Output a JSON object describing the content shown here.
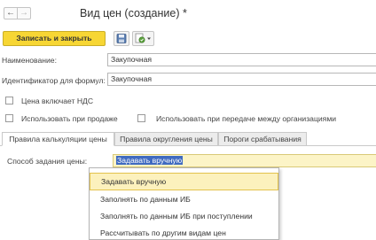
{
  "nav": {
    "back_icon": "arrow-left-icon",
    "forward_icon": "arrow-right-icon"
  },
  "title": "Вид цен (создание) *",
  "toolbar": {
    "save_close_label": "Записать и закрыть",
    "save_icon": "floppy-disk-icon",
    "generate_icon": "generate-dropdown-icon"
  },
  "form": {
    "name_label": "Наименование:",
    "name_value": "Закупочная",
    "formula_id_label": "Идентификатор для формул:",
    "formula_id_value": "Закупочная",
    "vat_checkbox_label": "Цена включает НДС",
    "vat_checked": false,
    "use_sale_label": "Использовать при продаже",
    "use_sale_checked": false,
    "use_transfer_label": "Использовать при передаче между организациями",
    "use_transfer_checked": false
  },
  "tabs": [
    {
      "label": "Правила калькуляции цены",
      "active": true
    },
    {
      "label": "Правила округления цены",
      "active": false
    },
    {
      "label": "Пороги срабатывания",
      "active": false
    }
  ],
  "pricing": {
    "method_label": "Способ задания цены:",
    "method_value": "Задавать вручную",
    "options": [
      "Задавать вручную",
      "Заполнять по данным ИБ",
      "Заполнять по данным ИБ при поступлении",
      "Рассчитывать по другим видам цен"
    ],
    "selected_index": 0
  }
}
